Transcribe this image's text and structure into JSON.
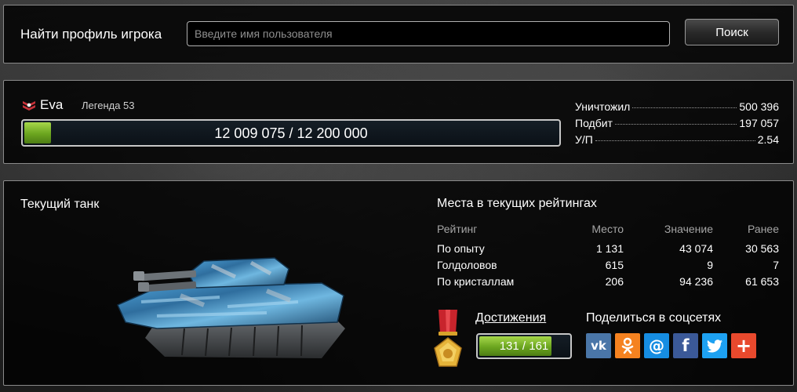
{
  "search": {
    "label": "Найти профиль игрока",
    "placeholder": "Введите имя пользователя",
    "button_label": "Поиск"
  },
  "player": {
    "name": "Eva",
    "rank": "Легенда 53",
    "xp_current": 12009075,
    "xp_max": 12200000,
    "xp_text": "12 009 075 / 12 200 000",
    "stats": [
      {
        "label": "Уничтожил",
        "value": "500 396"
      },
      {
        "label": "Подбит",
        "value": "197 057"
      },
      {
        "label": "У/П",
        "value": "2.54"
      }
    ]
  },
  "tank": {
    "title": "Текущий танк"
  },
  "ratings": {
    "title": "Места в текущих рейтингах",
    "headers": [
      "Рейтинг",
      "Место",
      "Значение",
      "Ранее"
    ],
    "rows": [
      [
        "По опыту",
        "1 131",
        "43 074",
        "30 563"
      ],
      [
        "Голдоловов",
        "615",
        "9",
        "7"
      ],
      [
        "По кристаллам",
        "206",
        "94 236",
        "61 653"
      ]
    ]
  },
  "achievements": {
    "label": "Достижения",
    "current": 131,
    "total": 161,
    "text": "131 / 161"
  },
  "share": {
    "title": "Поделиться в соцсетях",
    "networks": [
      {
        "icon": "vk-icon",
        "glyph": "vk",
        "color": "#4a76a8"
      },
      {
        "icon": "odnoklassniki-icon",
        "glyph": "ок",
        "color": "#f58220"
      },
      {
        "icon": "mailru-icon",
        "glyph": "@",
        "color": "#168de2"
      },
      {
        "icon": "facebook-icon",
        "glyph": "f",
        "color": "#3b5998"
      },
      {
        "icon": "twitter-icon",
        "glyph": "🐦",
        "color": "#1da1f2"
      },
      {
        "icon": "more-share-icon",
        "glyph": "+",
        "color": "#e8492d"
      }
    ]
  },
  "colors": {
    "progress_green": "#7bb52a",
    "panel_border": "#8a8a8a"
  }
}
